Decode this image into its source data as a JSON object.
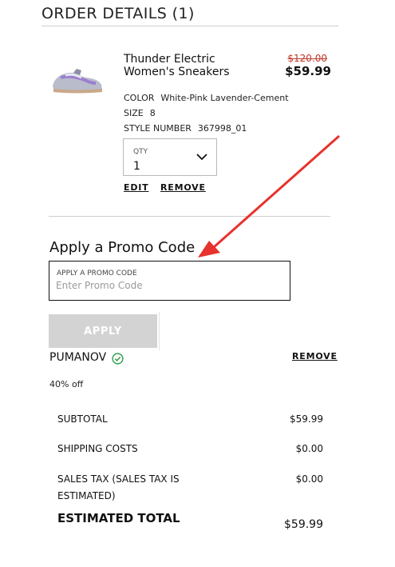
{
  "order": {
    "title": "ORDER DETAILS (1)"
  },
  "item": {
    "name": "Thunder Electric Women's Sneakers",
    "old_price": "$120.00",
    "price": "$59.99",
    "image_icon": "sneaker-image",
    "attributes": {
      "color_label": "COLOR",
      "color_value": "White-Pink Lavender-Cement",
      "size_label": "SIZE",
      "size_value": "8",
      "style_label": "STYLE NUMBER",
      "style_value": "367998_01"
    },
    "qty": {
      "label": "QTY",
      "value": "1"
    },
    "edit_label": "EDIT",
    "remove_label": "REMOVE"
  },
  "promo": {
    "heading": "Apply a Promo Code",
    "field_label": "APPLY A PROMO CODE",
    "placeholder": "Enter Promo Code",
    "value": "",
    "apply_label": "APPLY",
    "applied_code": "PUMANOV",
    "remove_label": "REMOVE",
    "discount": "40% off"
  },
  "summary": {
    "subtotal_label": "SUBTOTAL",
    "subtotal_value": "$59.99",
    "shipping_label": "SHIPPING COSTS",
    "shipping_value": "$0.00",
    "tax_label": "SALES TAX (SALES TAX IS ESTIMATED)",
    "tax_value": "$0.00",
    "total_label": "ESTIMATED TOTAL",
    "total_value": "$59.99"
  },
  "colors": {
    "annotation_arrow": "#e8322d",
    "check_green": "#2e9e4f",
    "old_price_red": "#c0392b",
    "apply_disabled": "#d3d3d3"
  }
}
